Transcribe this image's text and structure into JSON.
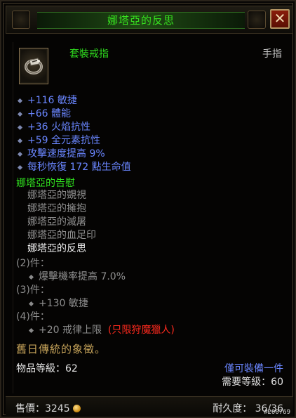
{
  "title": "娜塔亞的反思",
  "close_label": "✕",
  "item": {
    "type": "套裝戒指",
    "slot": "手指",
    "icon": "ring-icon"
  },
  "affixes": [
    "+116 敏捷",
    "+66 體能",
    "+36 火焰抗性",
    "+59 全元素抗性",
    "攻擊速度提高 9%",
    "每秒恢復 172 點生命值"
  ],
  "set": {
    "name": "娜塔亞的告慰",
    "pieces": [
      {
        "name": "娜塔亞的覬視",
        "owned": false
      },
      {
        "name": "娜塔亞的擁抱",
        "owned": false
      },
      {
        "name": "娜塔亞的滅屠",
        "owned": false
      },
      {
        "name": "娜塔亞的血足印",
        "owned": false
      },
      {
        "name": "娜塔亞的反思",
        "owned": true
      }
    ],
    "bonuses": [
      {
        "count": "(2)件：",
        "effect": "爆擊機率提高 7.0%"
      },
      {
        "count": "(3)件：",
        "effect": "+130 敏捷"
      },
      {
        "count": "(4)件：",
        "effect": "+20 戒律上限",
        "restriction": "(只限狩魔獵人)"
      }
    ]
  },
  "flavor": "舊日傳統的象徵。",
  "item_level": "物品等級：62",
  "equip_note": "僅可裝備一件",
  "required_level": "需要等級：60",
  "footer": {
    "sell": "售價：3245",
    "durability": "耐久度：  36/36",
    "watermark": "#200769"
  },
  "colors": {
    "set_green": "#30e11f",
    "magic_blue": "#6a86ff",
    "inactive_gray": "#8f8f8f",
    "restriction_red": "#ff2a1e",
    "flavor_gold": "#c7a45a"
  }
}
